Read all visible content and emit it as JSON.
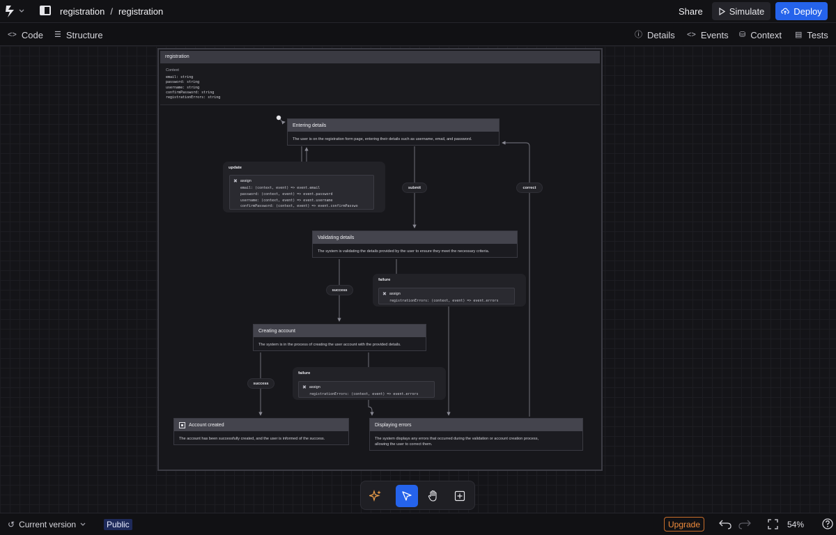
{
  "header": {
    "breadcrumb_project": "registration",
    "breadcrumb_separator": "/",
    "breadcrumb_machine": "registration",
    "share_label": "Share",
    "simulate_label": "Simulate",
    "deploy_label": "Deploy",
    "deploy_color": "#2563eb"
  },
  "subnav": {
    "code_label": "Code",
    "structure_label": "Structure",
    "details_label": "Details",
    "events_label": "Events",
    "context_label": "Context",
    "tests_label": "Tests"
  },
  "machine": {
    "title": "registration",
    "context_label": "Context",
    "context_lines": [
      "email: string",
      "password: string",
      "username: string",
      "confirmPassword: string",
      "registrationErrors: string"
    ]
  },
  "states": {
    "entering": {
      "title": "Entering details",
      "description": "The user is on the registration form page, entering their details such as username, email, and password."
    },
    "validating": {
      "title": "Validating details",
      "description": "The system is validating the details provided by the user to ensure they meet the necessary criteria."
    },
    "creating": {
      "title": "Creating account",
      "description": "The system is in the process of creating the user account with the provided details."
    },
    "created": {
      "title": "Account created",
      "description": "The account has been successfully created, and the user is informed of the success."
    },
    "errors": {
      "title": "Displaying errors",
      "description_line1": "The system displays any errors that occurred during the validation or account creation process,",
      "description_line2": "allowing the user to correct them."
    }
  },
  "transitions": {
    "update": {
      "event": "update",
      "action": "assign",
      "lines": [
        "email: (context, event) => event.email",
        "password: (context, event) => event.password",
        "username: (context, event) => event.username",
        "confirmPassword: (context, event) => event.confirmPasswo"
      ]
    },
    "submit": "submit",
    "correct": "correct",
    "validating_success": "success",
    "validating_failure": {
      "event": "failure",
      "action": "assign",
      "line": "registrationErrors: (context, event) => event.errors"
    },
    "creating_success": "success",
    "creating_failure": {
      "event": "failure",
      "action": "assign",
      "line": "registrationErrors: (context, event) => event.errors"
    }
  },
  "toolbar_icons": [
    "sparkle-icon",
    "pointer-icon",
    "hand-icon",
    "add-state-icon"
  ],
  "footer": {
    "version_label": "Current version",
    "visibility_label": "Public",
    "upgrade_label": "Upgrade",
    "upgrade_color": "#f08c3c",
    "zoom_level": "54%"
  }
}
